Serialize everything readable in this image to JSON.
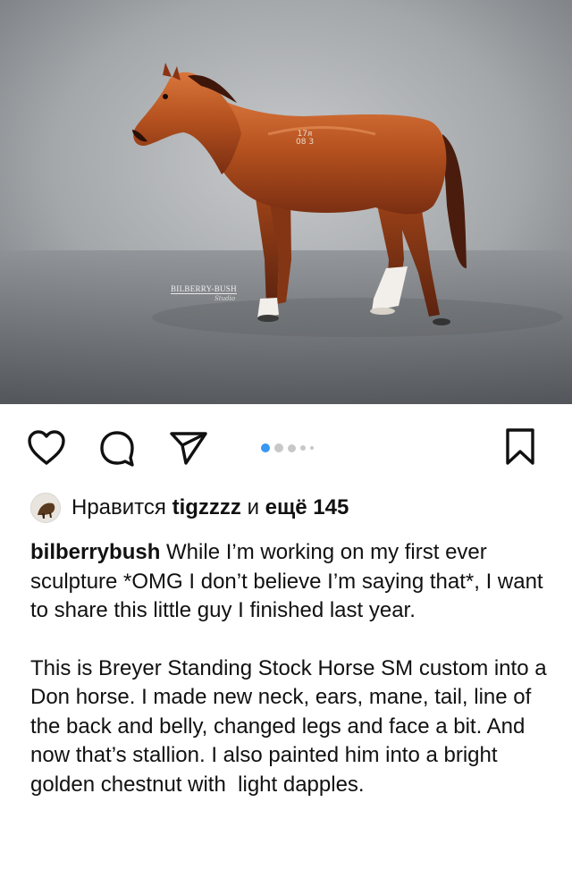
{
  "photo": {
    "alt_subject": "horse-figurine",
    "watermark": "BILBERRY-BUSH",
    "watermark_sub": "Studio",
    "mark_line1": "17ᴙ",
    "mark_line2": "08 3"
  },
  "actions": {
    "like_icon": "heart-icon",
    "comment_icon": "comment-icon",
    "share_icon": "paper-plane-icon",
    "save_icon": "bookmark-icon",
    "carousel_active_index": 0,
    "carousel_count": 5
  },
  "likes": {
    "prefix": "Нравится ",
    "user": "tigzzzz",
    "middle": " и ",
    "others": "ещё 145"
  },
  "caption": {
    "username": "bilberrybush",
    "text_1": " While I’m working on my first ever sculpture *OMG I don’t believe I’m saying that*, I want to share this little guy I finished last year.",
    "text_2": "This is Breyer Standing Stock Horse SM custom into a Don horse. I made new neck, ears, mane, tail, line of the back and belly, changed legs and face a bit. And now that’s stallion. I also painted him into a bright golden chestnut with  light dapples."
  },
  "colors": {
    "accent_dot": "#3897f0",
    "horse_body": "#b5531f",
    "background_gray": "#8f9296"
  }
}
